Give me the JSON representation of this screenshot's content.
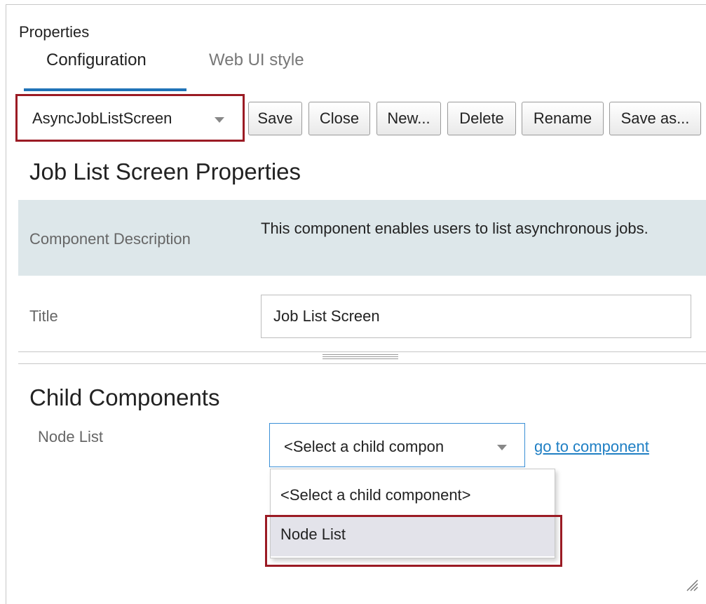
{
  "panel": {
    "title": "Properties",
    "tabs": [
      {
        "label": "Configuration",
        "active": true
      },
      {
        "label": "Web UI style",
        "active": false
      }
    ]
  },
  "toolbar": {
    "screen_select_value": "AsyncJobListScreen",
    "buttons": [
      "Save",
      "Close",
      "New...",
      "Delete",
      "Rename",
      "Save as..."
    ]
  },
  "main": {
    "heading": "Job List Screen Properties",
    "description_label": "Component Description",
    "description_text": "This component enables users to list asynchronous jobs.",
    "title_label": "Title",
    "title_value": "Job List Screen"
  },
  "child": {
    "heading": "Child Components",
    "node_label": "Node List",
    "select_value": "<Select a child compon",
    "link": "go to component",
    "options": [
      "<Select a child component>",
      "Node List"
    ]
  },
  "colors": {
    "accent": "#1f73b7",
    "highlight": "#9b1b24",
    "description_bg": "#dde7ea",
    "link": "#1f7fc4"
  }
}
